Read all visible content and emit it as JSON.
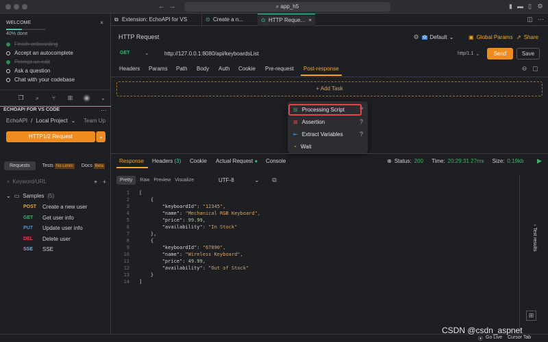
{
  "titlebar": {
    "search": "app_h5"
  },
  "welcome": {
    "title": "WELCOME",
    "progress_text": "40% done",
    "progress_pct": 40,
    "steps": [
      {
        "label": "Finish onboarding",
        "done": true
      },
      {
        "label": "Accept an autocomplete",
        "done": false
      },
      {
        "label": "Prompt an edit",
        "done": true
      },
      {
        "label": "Ask a question",
        "done": false
      },
      {
        "label": "Chat with your codebase",
        "done": false
      }
    ]
  },
  "sidebar": {
    "section_title": "ECHOAPI FOR VS CODE",
    "crumb_root": "EchoAPI",
    "crumb_sep": "/",
    "crumb_project": "Local Project",
    "team": "Team Up",
    "http_button": "HTTP1/2 Request",
    "tabs": [
      {
        "label": "Requests"
      },
      {
        "label": "Tests",
        "badge": "No Limits"
      },
      {
        "label": "Docs",
        "badge": "Beta"
      }
    ],
    "search_placeholder": "Keyword/URL",
    "folder": {
      "name": "Samples",
      "count": "(5)"
    },
    "items": [
      {
        "method": "POST",
        "label": "Create a new user",
        "color": "#f5a623"
      },
      {
        "method": "GET",
        "label": "Get user info",
        "color": "#3fb26b"
      },
      {
        "method": "PUT",
        "label": "Update user info",
        "color": "#4a90e2"
      },
      {
        "method": "DEL",
        "label": "Delete user",
        "color": "#e0474c"
      },
      {
        "method": "SSE",
        "label": "SSE",
        "color": "#4fc3d6"
      }
    ]
  },
  "editor_tabs": [
    {
      "label": "Extension: EchoAPI for VS Code"
    },
    {
      "label": "Create a n..."
    },
    {
      "label": "HTTP Reque..."
    }
  ],
  "request": {
    "title": "HTTP Request",
    "env": "Default",
    "global_params": "Global Params",
    "share": "Share",
    "method": "GET",
    "url": "http://127.0.0.1:8080/api/keyboardsList",
    "http_version": "http/1.1",
    "send": "Send",
    "save": "Save",
    "subtabs": [
      "Headers",
      "Params",
      "Path",
      "Body",
      "Auth",
      "Cookie",
      "Pre-request",
      "Post-response"
    ],
    "add_task": "+ Add Task"
  },
  "menu": {
    "items": [
      {
        "label": "Processing Script",
        "icon": "script-icon"
      },
      {
        "label": "Assertion",
        "icon": "check-icon"
      },
      {
        "label": "Extract Variables",
        "icon": "extract-icon"
      },
      {
        "label": "Wait",
        "icon": "clock-icon"
      }
    ]
  },
  "response": {
    "tabs": [
      "Response",
      "Headers",
      "Cookie",
      "Actual Request",
      "Console"
    ],
    "headers_count": "(3)",
    "status_label": "Status:",
    "status": "200",
    "time_label": "Time:",
    "time": "20:29:31 27ms",
    "size_label": "Size:",
    "size": "0.19kb",
    "views": [
      "Pretty",
      "Raw",
      "Preview",
      "Visualize"
    ],
    "encoding": "UTF-8",
    "code_lines": [
      "[",
      "    {",
      "        \"keyboardId\": \"12345\",",
      "        \"name\": \"Mechanical RGB Keyboard\",",
      "        \"price\": 99.99,",
      "        \"availability\": \"In Stock\"",
      "    },",
      "    {",
      "        \"keyboardId\": \"67890\",",
      "        \"name\": \"Wireless Keyboard\",",
      "        \"price\": 49.99,",
      "        \"availability\": \"Out of Stock\"",
      "    }",
      "]"
    ],
    "test_results": "Test results"
  },
  "footer": {
    "go_live": "Go Live",
    "cursor_tab": "Cursor Tab",
    "watermark": "CSDN @csdn_aspnet"
  }
}
